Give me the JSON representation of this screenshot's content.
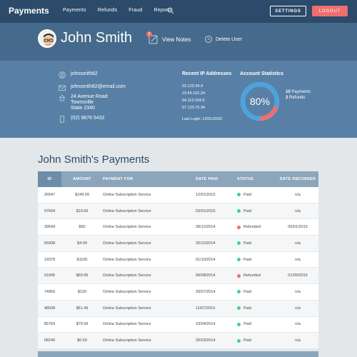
{
  "topbar": {
    "brand": "Payments",
    "nav": [
      "Payments",
      "Refunds",
      "Fraud",
      "Reports"
    ],
    "settings": "SETTINGS",
    "logout": "LOGOUT"
  },
  "profile": {
    "name": "John Smith",
    "notes_badge": "2",
    "view_notes": "View Notes",
    "delete_user": "Delete User"
  },
  "info": {
    "username": "johnsmith82",
    "email": "johnsmith82@email.com",
    "address1": "24 Avenue Road",
    "address2": "Townsville",
    "address3": "State 2340",
    "phone": "(02) 9876 5432",
    "ip_title": "Recent IP Addresses",
    "ips": [
      "23.120.34.4",
      "23.45.101.24",
      "94.113.104.6",
      "67.123.75.34"
    ],
    "last_login": "Last Login: 12/01/2015",
    "stats_title": "Account Statistics",
    "stats_percent": "80%",
    "stats_percent_value": 0.8,
    "payments_count": "10",
    "payments_label": "Payments",
    "refunds_count": "2",
    "refunds_label": "Refunds"
  },
  "payments": {
    "title": "John Smith's Payments",
    "headers": {
      "id": "ID",
      "amount": "AMOUNT",
      "for": "PAYMENT FOR",
      "date": "DATE PAID",
      "status": "STATUS",
      "refunded": "DATE REFUNDED"
    },
    "rows": [
      {
        "id": "26547",
        "amount": "$249.99",
        "for": "Online Subscription Service",
        "date": "12/01/2015",
        "status": "Paid",
        "refunded": "n/a"
      },
      {
        "id": "97694",
        "amount": "$19.99",
        "for": "Online Subscription Service",
        "date": "03/01/2015",
        "status": "Paid",
        "refunded": "n/a"
      },
      {
        "id": "39549",
        "amount": "$50",
        "for": "Online Subscription Service",
        "date": "28/12/2014",
        "status": "Refunded",
        "refunded": "05/01/2015"
      },
      {
        "id": "65938",
        "amount": "$4.99",
        "for": "Online Subscription Service",
        "date": "20/12/2014",
        "status": "Paid",
        "refunded": "n/a"
      },
      {
        "id": "19378",
        "amount": "$1100",
        "for": "Online Subscription Service",
        "date": "01/10/2014",
        "status": "Paid",
        "refunded": "n/a"
      },
      {
        "id": "01845",
        "amount": "$69.95",
        "for": "Online Subscription Service",
        "date": "09/08/2014",
        "status": "Refunded",
        "refunded": "01/09/2015"
      },
      {
        "id": "74956",
        "amount": "$120",
        "for": "Online Subscription Service",
        "date": "29/07/2014",
        "status": "Paid",
        "refunded": "n/a"
      },
      {
        "id": "48938",
        "amount": "$51.49",
        "for": "Online Subscription Service",
        "date": "11/07/2014",
        "status": "Paid",
        "refunded": "n/a"
      },
      {
        "id": "85769",
        "amount": "$79.99",
        "for": "Online Subscription Service",
        "date": "23/04/2014",
        "status": "Paid",
        "refunded": "n/a"
      },
      {
        "id": "08240",
        "amount": "$0.50",
        "for": "Online Subscription Service",
        "date": "20/03/2014",
        "status": "Paid",
        "refunded": "n/a"
      }
    ]
  },
  "colors": {
    "paid": "#3fcf9d",
    "refunded": "#ef6e6e",
    "accent": "#ef6e6e",
    "donut_main": "#4aa3df"
  }
}
